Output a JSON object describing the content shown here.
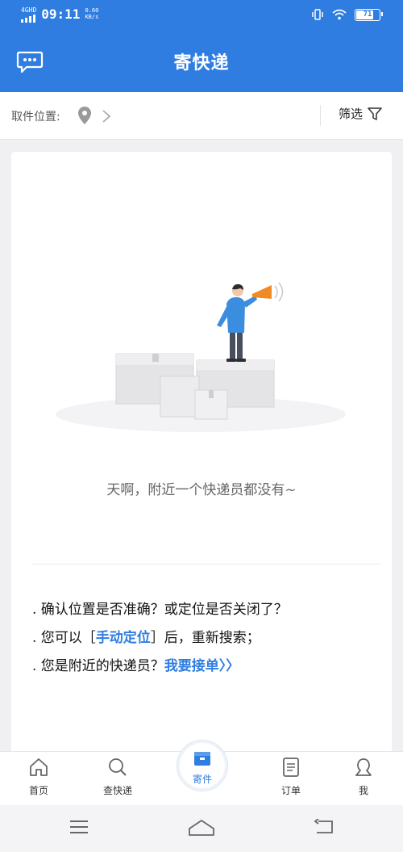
{
  "status_bar": {
    "network": "4GHD",
    "time": "09:11",
    "speed_value": "0.60",
    "speed_unit": "KB/s",
    "battery": "71"
  },
  "header": {
    "title": "寄快递",
    "message_icon": "chat-bubble-icon"
  },
  "filter_bar": {
    "location_label": "取件位置:",
    "filter_label": "筛选"
  },
  "empty_state": {
    "message": "天啊，附近一个快递员都没有~"
  },
  "tips": {
    "line1": ". 确认位置是否准确？或定位是否关闭了？",
    "line2_prefix": ". 您可以［",
    "line2_link": "手动定位",
    "line2_suffix": "］后，重新搜索；",
    "line3_prefix": ". 您是附近的快递员？",
    "line3_link": "我要接单〉〉"
  },
  "tabbar": {
    "items": [
      {
        "label": "首页",
        "icon": "home-icon"
      },
      {
        "label": "查快递",
        "icon": "search-icon"
      },
      {
        "label": "寄件",
        "icon": "package-icon",
        "active": true
      },
      {
        "label": "订单",
        "icon": "document-icon"
      },
      {
        "label": "我",
        "icon": "user-icon"
      }
    ]
  },
  "colors": {
    "primary": "#2f7de1",
    "accent_orange": "#f08a24"
  }
}
